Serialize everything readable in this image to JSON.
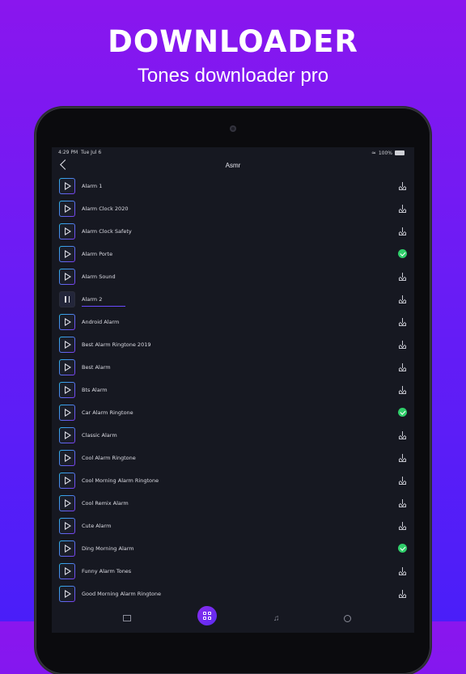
{
  "promo": {
    "title": "DOWNLOADER",
    "subtitle": "Tones downloader pro"
  },
  "status_bar": {
    "time": "4:29 PM",
    "date": "Tue Jul 6",
    "battery": "100%",
    "icons": [
      "wifi-icon",
      "battery-icon"
    ]
  },
  "nav": {
    "title": "Asmr",
    "back_icon": "chevron-left-icon"
  },
  "tracks": [
    {
      "name": "Alarm 1",
      "state": "download"
    },
    {
      "name": "Alarm Clock 2020",
      "state": "download"
    },
    {
      "name": "Alarm Clock Safety",
      "state": "download"
    },
    {
      "name": "Alarm Porte",
      "state": "downloaded"
    },
    {
      "name": "Alarm Sound",
      "state": "download"
    },
    {
      "name": "Alarm 2",
      "state": "download",
      "playing": true
    },
    {
      "name": "Android Alarm",
      "state": "download"
    },
    {
      "name": "Best Alarm Ringtone 2019",
      "state": "download"
    },
    {
      "name": "Best Alarm",
      "state": "download"
    },
    {
      "name": "Bts Alarm",
      "state": "download"
    },
    {
      "name": "Car Alarm Ringtone",
      "state": "downloaded"
    },
    {
      "name": "Classic Alarm",
      "state": "download"
    },
    {
      "name": "Cool Alarm Ringtone",
      "state": "download"
    },
    {
      "name": "Cool Morning  Alarm Ringtone",
      "state": "download"
    },
    {
      "name": "Cool Remix Alarm",
      "state": "download"
    },
    {
      "name": "Cute Alarm",
      "state": "download"
    },
    {
      "name": "Ding Morning Alarm",
      "state": "downloaded"
    },
    {
      "name": "Funny Alarm Tones",
      "state": "download"
    },
    {
      "name": "Good Morning Alarm Ringtone",
      "state": "download"
    }
  ],
  "tab_bar": {
    "tabs": [
      "home-icon",
      "categories-icon",
      "music-icon",
      "settings-icon"
    ],
    "active": "categories-icon"
  },
  "colors": {
    "background_top": "#8a16ee",
    "background_bottom": "#4a1ef9",
    "screen": "#161821",
    "downloaded": "#2fce6a",
    "accent": "#6a49ff"
  }
}
